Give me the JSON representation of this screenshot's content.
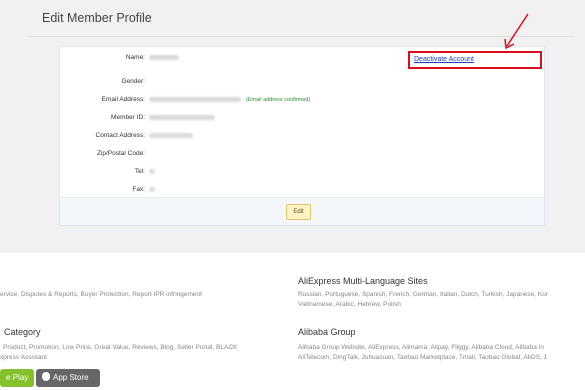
{
  "profile": {
    "title": "Edit Member Profile",
    "deactivate_label": "Deactivate Account",
    "edit_label": "Edit",
    "email_confirmed_note": "(Email address confirmed)",
    "fields": {
      "name": "Name:",
      "gender": "Gender:",
      "email": "Email Address:",
      "member_id": "Member ID:",
      "contact_address": "Contact Address:",
      "zip": "Zip/Postal Code:",
      "tel": "Tel:",
      "fax": "Fax:"
    }
  },
  "footer": {
    "help_line": "ervice, Disputes & Reports, Buyer Protection, Report IPR infringement",
    "category_heading": "Category",
    "category_line1": "Product, Promotion, Low Price, Great Value, Reviews, Blog, Seller Portal, BLACK",
    "category_line2": "xpress Assistant",
    "multilang_heading": "AliExpress Multi-Language Sites",
    "multilang_line1": "Russian, Portuguese, Spanish, French, German, Italian, Dutch, Turkish, Japanese, Kor",
    "multilang_line2": "Vietnamese, Arabic, Hebrew, Polish",
    "group_heading": "Alibaba Group",
    "group_line1": "Alibaba Group Website, AliExpress, Alimama, Alipay, Fliggy, Alibaba Cloud, Alibaba In",
    "group_line2": "AliTelecom, DingTalk, Juhuasuan, Taobao Marketplace, Tmall, Taobao Global, AliOS, 1",
    "google_play_label": "e Play",
    "app_store_label": "App Store"
  },
  "colors": {
    "highlight_border": "#d8101e",
    "link": "#1f3fb7",
    "confirmed": "#2e8b2e"
  }
}
